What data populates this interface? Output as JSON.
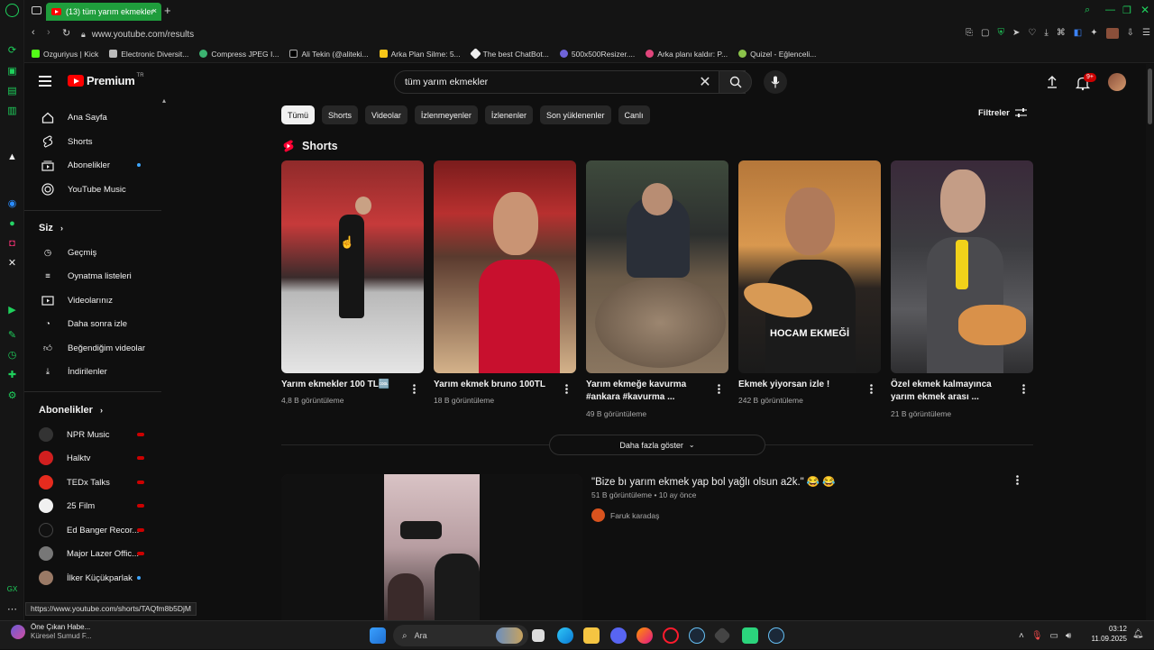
{
  "browser": {
    "tab_title": "(13) tüm yarım ekmekler",
    "url": "www.youtube.com/results",
    "bookmarks": [
      "Ozguriyus | Kick",
      "Electronic Diversit...",
      "Compress JPEG I...",
      "Ali Tekin (@aliteki...",
      "Arka Plan Silme: 5...",
      "The best ChatBot...",
      "500x500Resizer....",
      "Arka planı kaldır: P...",
      "Quizel - Eğlenceli..."
    ]
  },
  "header": {
    "logo_text": "Premium",
    "logo_region": "TR",
    "search_value": "tüm yarım ekmekler",
    "notif_badge": "9+"
  },
  "sidebar": {
    "main": [
      "Ana Sayfa",
      "Shorts",
      "Abonelikler",
      "YouTube Music"
    ],
    "you_title": "Siz",
    "you": [
      "Geçmiş",
      "Oynatma listeleri",
      "Videolarınız",
      "Daha sonra izle",
      "Beğendiğim videolar",
      "İndirilenler"
    ],
    "subs_title": "Abonelikler",
    "subs": [
      "NPR Music",
      "Halktv",
      "TEDx Talks",
      "25 Film",
      "Ed Banger Recor...",
      "Major Lazer Offic...",
      "İlker Küçükparlak"
    ]
  },
  "chips": [
    "Tümü",
    "Shorts",
    "Videolar",
    "İzlenmeyenler",
    "İzlenenler",
    "Son yüklenenler",
    "Canlı"
  ],
  "filters_label": "Filtreler",
  "shorts_title": "Shorts",
  "shorts": [
    {
      "title": "Yarım ekmekler 100 TL🆒",
      "views": "4,8 B görüntüleme"
    },
    {
      "title": "Yarım ekmek bruno 100TL",
      "views": "18 B görüntüleme"
    },
    {
      "title": "Yarım ekmeğe kavurma #ankara #kavurma ...",
      "views": "49 B görüntüleme"
    },
    {
      "title": "Ekmek yiyorsan izle !",
      "views": "242 B görüntüleme",
      "overlay": "HOCAM EKMEĞİ"
    },
    {
      "title": "Özel ekmek kalmayınca yarım ekmek arası ...",
      "views": "21 B görüntüleme"
    }
  ],
  "more_label": "Daha fazla göster",
  "video": {
    "title": "\"Bize bı yarım ekmek yap bol yağlı olsun a2k.\" 😂 😂",
    "meta": "51 B görüntüleme • 10 ay önce",
    "channel": "Faruk karadaş"
  },
  "status_url": "https://www.youtube.com/shorts/TAQfm8b5DjM",
  "taskbar": {
    "news_title": "Öne Çıkan Habe...",
    "news_sub": "Küresel Sumud F...",
    "search_label": "Ara",
    "time": "03:12",
    "date": "11.09.2025"
  },
  "colors": {
    "accent_green": "#1fd05c",
    "yt_red": "#ff0000",
    "live_red": "#cc0000"
  }
}
